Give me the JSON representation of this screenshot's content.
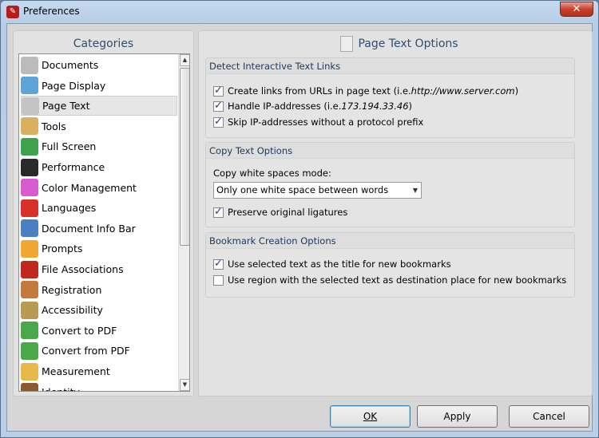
{
  "window": {
    "title": "Preferences",
    "close": "✕"
  },
  "categories": {
    "title": "Categories",
    "items": [
      {
        "label": "Documents",
        "color": "#bbbbbb"
      },
      {
        "label": "Page Display",
        "color": "#5fa4d8"
      },
      {
        "label": "Page Text",
        "color": "#c4c4c4",
        "selected": true
      },
      {
        "label": "Tools",
        "color": "#d8b060"
      },
      {
        "label": "Full Screen",
        "color": "#3fa34d"
      },
      {
        "label": "Performance",
        "color": "#2a2a2a"
      },
      {
        "label": "Color Management",
        "color": "#d95bd1"
      },
      {
        "label": "Languages",
        "color": "#d9302a"
      },
      {
        "label": "Document Info Bar",
        "color": "#4a7fc1"
      },
      {
        "label": "Prompts",
        "color": "#f0a830"
      },
      {
        "label": "File Associations",
        "color": "#c0281e"
      },
      {
        "label": "Registration",
        "color": "#c47a3a"
      },
      {
        "label": "Accessibility",
        "color": "#b89a50"
      },
      {
        "label": "Convert to PDF",
        "color": "#4aa84a"
      },
      {
        "label": "Convert from PDF",
        "color": "#4aa84a"
      },
      {
        "label": "Measurement",
        "color": "#e8b84a"
      },
      {
        "label": "Identity",
        "color": "#8a5a30"
      }
    ]
  },
  "main": {
    "title": "Page Text Options",
    "detect": {
      "title": "Detect Interactive Text Links",
      "create_links": {
        "label": "Create links from URLs in page text (i.e. ",
        "example": "http://www.server.com",
        "suffix": ")",
        "checked": true
      },
      "handle_ip": {
        "label": "Handle IP-addresses (i.e. ",
        "example": "173.194.33.46",
        "suffix": ")",
        "checked": true
      },
      "skip_ip": {
        "label": "Skip IP-addresses without a protocol prefix",
        "checked": true
      }
    },
    "copy": {
      "title": "Copy Text Options",
      "mode_label": "Copy white spaces mode:",
      "mode_value": "Only one white space between words",
      "ligatures": {
        "label": "Preserve original ligatures",
        "checked": true
      }
    },
    "bookmark": {
      "title": "Bookmark Creation Options",
      "use_title": {
        "label": "Use selected text as the title for new bookmarks",
        "checked": true
      },
      "use_region": {
        "label": "Use region with the selected text as destination place for new bookmarks",
        "checked": false
      }
    }
  },
  "buttons": {
    "ok": "OK",
    "apply": "Apply",
    "cancel": "Cancel"
  }
}
